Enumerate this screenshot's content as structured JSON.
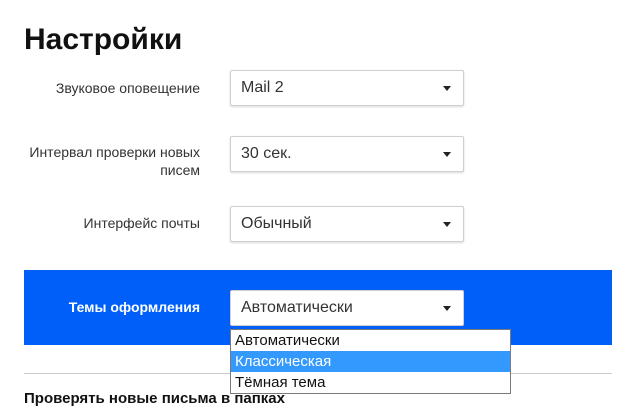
{
  "page": {
    "title": "Настройки"
  },
  "settings": [
    {
      "label": "Звуковое оповещение",
      "value": "Mail 2"
    },
    {
      "label": "Интервал проверки новых писем",
      "value": "30 сек."
    },
    {
      "label": "Интерфейс почты",
      "value": "Обычный"
    }
  ],
  "themes": {
    "label": "Темы оформления",
    "value": "Автоматически",
    "band_color": "#005ff9",
    "options": [
      "Автоматически",
      "Классическая",
      "Тёмная тема"
    ],
    "highlighted_option": "Классическая",
    "highlight_color": "#3399ff"
  },
  "next_section": {
    "heading": "Проверять новые письма в папках"
  },
  "icons": {
    "select_caret": "caret-down-icon"
  }
}
